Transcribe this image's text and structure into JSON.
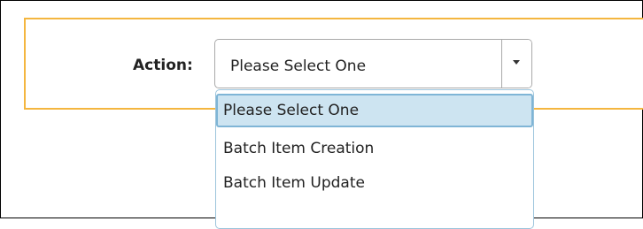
{
  "form": {
    "action_label": "Action:",
    "select": {
      "selected_value": "Please Select One",
      "options": [
        "Please Select One",
        "Batch Item Creation",
        "Batch Item Update"
      ],
      "highlighted_index": 0,
      "open": true
    }
  },
  "icons": {
    "dropdown_arrow": "chevron-down-icon"
  },
  "colors": {
    "panel_border": "#f4b63f",
    "highlight_bg": "#cde4f1",
    "highlight_border": "#7fb5d6",
    "option_list_border": "#9cc4dc"
  }
}
